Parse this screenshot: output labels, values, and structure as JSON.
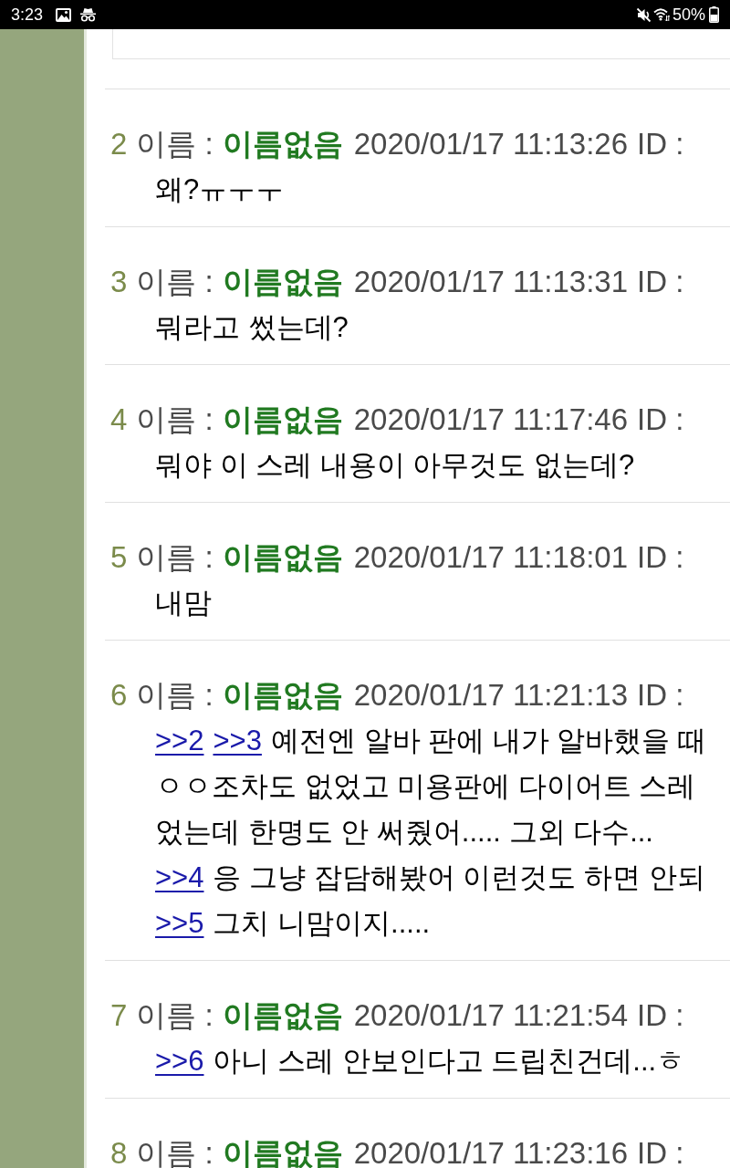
{
  "status_bar": {
    "time": "3:23",
    "battery": "50%"
  },
  "posts": [
    {
      "number": "2",
      "name_label": "이름 :",
      "name": "이름없음",
      "datetime": "2020/01/17 11:13:26",
      "id_label": "ID :",
      "lines": [
        [
          {
            "kind": "text",
            "text": "왜?ㅠㅜㅜ"
          }
        ]
      ]
    },
    {
      "number": "3",
      "name_label": "이름 :",
      "name": "이름없음",
      "datetime": "2020/01/17 11:13:31",
      "id_label": "ID :",
      "lines": [
        [
          {
            "kind": "text",
            "text": "뭐라고 썼는데?"
          }
        ]
      ]
    },
    {
      "number": "4",
      "name_label": "이름 :",
      "name": "이름없음",
      "datetime": "2020/01/17 11:17:46",
      "id_label": "ID :",
      "lines": [
        [
          {
            "kind": "text",
            "text": "뭐야 이 스레 내용이 아무것도 없는데?"
          }
        ]
      ]
    },
    {
      "number": "5",
      "name_label": "이름 :",
      "name": "이름없음",
      "datetime": "2020/01/17 11:18:01",
      "id_label": "ID :",
      "lines": [
        [
          {
            "kind": "text",
            "text": "내맘"
          }
        ]
      ]
    },
    {
      "number": "6",
      "name_label": "이름 :",
      "name": "이름없음",
      "datetime": "2020/01/17 11:21:13",
      "id_label": "ID :",
      "lines": [
        [
          {
            "kind": "link",
            "text": ">>2"
          },
          {
            "kind": "link",
            "text": ">>3"
          },
          {
            "kind": "text",
            "text": "예전엔 알바 판에 내가 알바했을 때"
          }
        ],
        [
          {
            "kind": "text",
            "text": "ㅇㅇ조차도 없었고 미용판에 다이어트 스레"
          }
        ],
        [
          {
            "kind": "text",
            "text": "었는데 한명도 안 써줬어..... 그외 다수..."
          }
        ],
        [
          {
            "kind": "link",
            "text": ">>4"
          },
          {
            "kind": "text",
            "text": "응 그냥 잡담해봤어 이런것도 하면 안되"
          }
        ],
        [
          {
            "kind": "link",
            "text": ">>5"
          },
          {
            "kind": "text",
            "text": "그치 니맘이지....."
          }
        ]
      ]
    },
    {
      "number": "7",
      "name_label": "이름 :",
      "name": "이름없음",
      "datetime": "2020/01/17 11:21:54",
      "id_label": "ID :",
      "lines": [
        [
          {
            "kind": "link",
            "text": ">>6"
          },
          {
            "kind": "text",
            "text": "아니 스레 안보인다고 드립친건데...ㅎ"
          }
        ]
      ]
    },
    {
      "number": "8",
      "name_label": "이름 :",
      "name": "이름없음",
      "datetime": "2020/01/17 11:23:16",
      "id_label": "ID :"
    }
  ]
}
